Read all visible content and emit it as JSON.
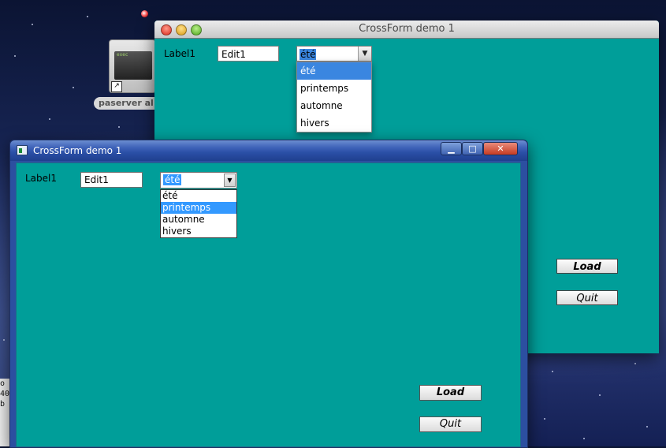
{
  "desktop": {
    "icon_label": "paserver al",
    "icon_screen_text": "exec",
    "terminal_fragment": "o\n40\nb"
  },
  "mac_window": {
    "title": "CrossForm demo 1",
    "label": "Label1",
    "edit_value": "Edit1",
    "combo_value": "été",
    "options": [
      "été",
      "printemps",
      "automne",
      "hivers"
    ],
    "selected_index": 0,
    "load_label": "Load",
    "quit_label": "Quit"
  },
  "win_window": {
    "title": "CrossForm demo 1",
    "label": "Label1",
    "edit_value": "Edit1",
    "combo_value": "été",
    "options": [
      "été",
      "printemps",
      "automne",
      "hivers"
    ],
    "selected_index": 1,
    "load_label": "Load",
    "quit_label": "Quit"
  },
  "colors": {
    "form_background": "#009e99",
    "selection_mac": "#3a86e0",
    "selection_win": "#3399ff"
  }
}
